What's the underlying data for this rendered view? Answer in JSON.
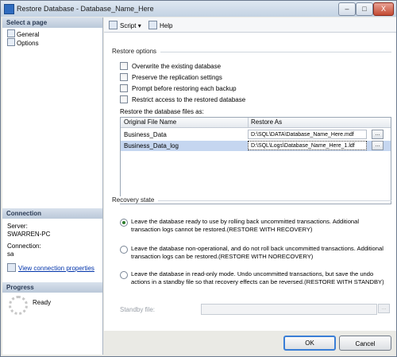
{
  "window": {
    "title": "Restore Database - Database_Name_Here",
    "min_label": "–",
    "max_label": "□",
    "close_label": "X"
  },
  "sidebar": {
    "select_page_header": "Select a page",
    "pages": [
      {
        "label": "General"
      },
      {
        "label": "Options"
      }
    ],
    "connection_header": "Connection",
    "server_label": "Server:",
    "server_value": "SWARREN-PC",
    "connection_label": "Connection:",
    "connection_value": "sa",
    "view_props_link": "View connection properties",
    "progress_header": "Progress",
    "progress_status": "Ready"
  },
  "toolbar": {
    "script_label": "Script",
    "help_label": "Help"
  },
  "restore_options": {
    "title": "Restore options",
    "checkboxes": [
      {
        "label": "Overwrite the existing database",
        "checked": false
      },
      {
        "label": "Preserve the replication settings",
        "checked": false
      },
      {
        "label": "Prompt before restoring each backup",
        "checked": false
      },
      {
        "label": "Restrict access to the restored database",
        "checked": false
      }
    ],
    "files_label": "Restore the database files as:",
    "columns": [
      "Original File Name",
      "Restore As"
    ],
    "rows": [
      {
        "original": "Business_Data",
        "restore_as": "D:\\SQL\\DATA\\Database_Name_Here.mdf",
        "browse": "..."
      },
      {
        "original": "Business_Data_log",
        "restore_as": "D:\\SQL\\Logs\\Database_Name_Here_1.ldf",
        "browse": "..."
      }
    ]
  },
  "recovery_state": {
    "title": "Recovery state",
    "options": [
      {
        "text": "Leave the database ready to use by rolling back uncommitted transactions. Additional transaction logs cannot be restored.(RESTORE WITH RECOVERY)",
        "selected": true
      },
      {
        "text": "Leave the database non-operational, and do not roll back uncommitted transactions. Additional transaction logs can be restored.(RESTORE WITH NORECOVERY)",
        "selected": false
      },
      {
        "text": "Leave the database in read-only mode. Undo uncommitted transactions, but save the undo actions in a standby file so that recovery effects can be reversed.(RESTORE WITH STANDBY)",
        "selected": false
      }
    ],
    "standby_label": "Standby file:",
    "standby_value": "",
    "standby_browse": "..."
  },
  "footer": {
    "ok_label": "OK",
    "cancel_label": "Cancel"
  }
}
